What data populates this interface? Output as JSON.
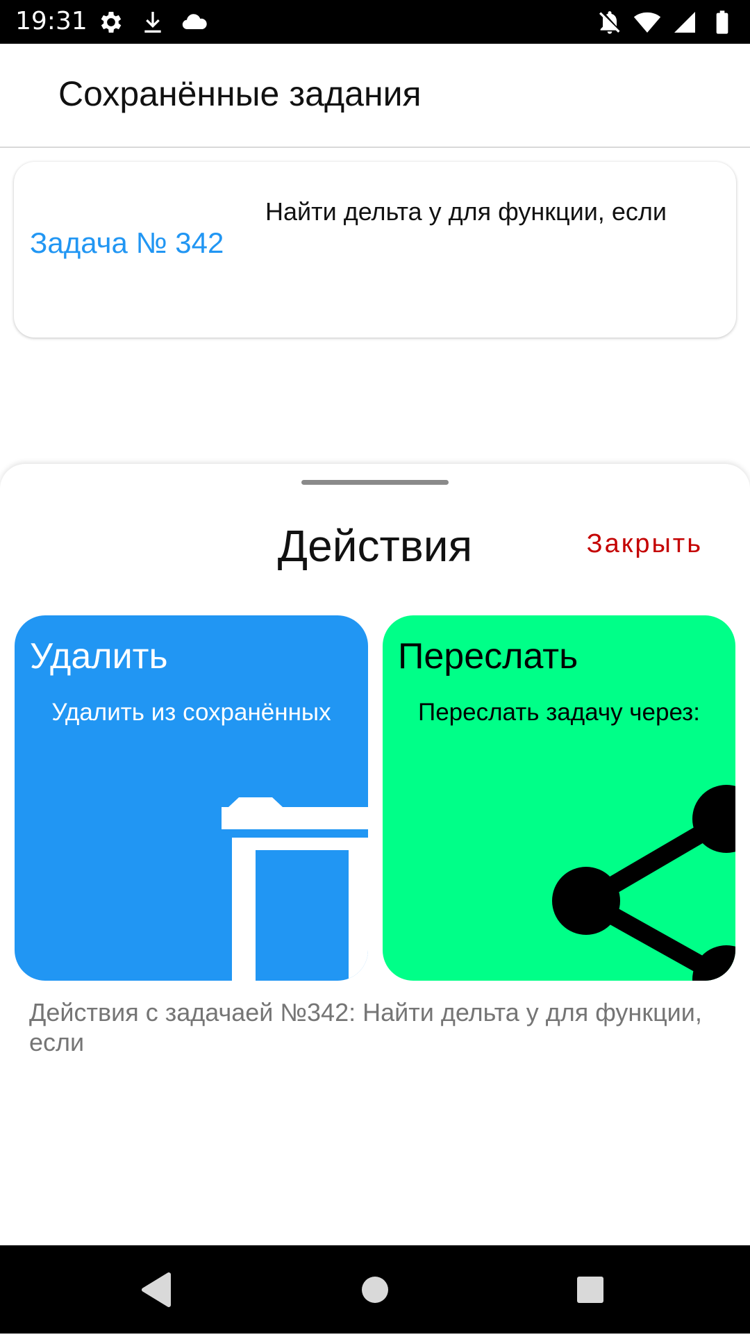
{
  "status_bar": {
    "time": "19:31",
    "left_icons": [
      "gear-icon",
      "download-icon",
      "cloud-icon"
    ],
    "right_icons": [
      "notifications-off-icon",
      "wifi-icon",
      "signal-icon",
      "battery-icon"
    ]
  },
  "app_bar": {
    "title": "Сохранённые задания"
  },
  "task_card": {
    "number_label": "Задача № 342",
    "text": "Найти дельта у для функции, если"
  },
  "bottom_sheet": {
    "title": "Действия",
    "close_label": "Закрыть",
    "actions": [
      {
        "title": "Удалить",
        "description": "Удалить из сохранённых",
        "icon": "trash-icon",
        "color": "#2196f3"
      },
      {
        "title": "Переслать",
        "description": "Переслать задачу через:",
        "icon": "share-icon",
        "color": "#00ff88"
      }
    ],
    "caption": "Действия с задачаей №342: Найти дельта у для функции, если"
  },
  "nav_bar": {
    "buttons": [
      "back-icon",
      "home-icon",
      "recents-icon"
    ]
  },
  "colors": {
    "accent_blue": "#2196f3",
    "share_green": "#00ff88",
    "close_red": "#c40000"
  }
}
